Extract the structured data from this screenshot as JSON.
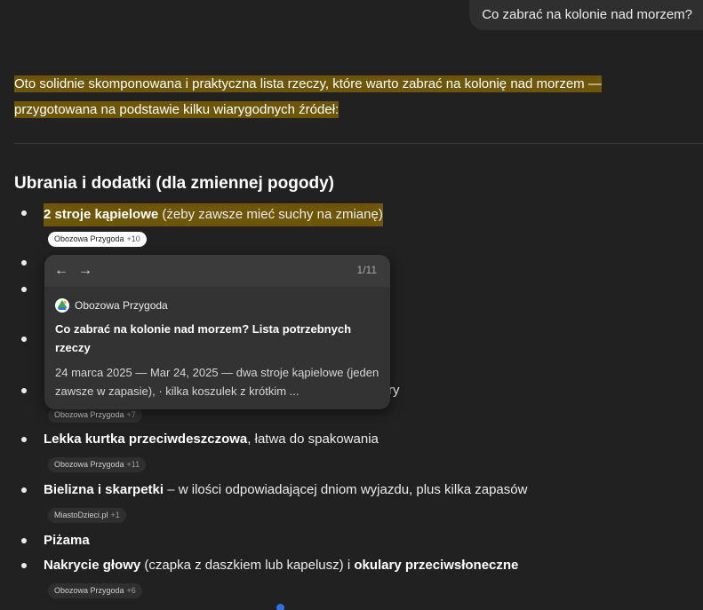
{
  "user_message": "Co zabrać na kolonie nad morzem?",
  "intro": "Oto solidnie skomponowana i praktyczna lista rzeczy, które warto zabrać na kolonię nad morzem — przygotowana na podstawie kilku wiarygodnych źródeł:",
  "section_heading": "Ubrania i dodatki (dla zmiennej pogody)",
  "items": [
    {
      "bold": "2 stroje kąpielowe",
      "rest": " (żeby zawsze mieć suchy na zmianę)"
    },
    {
      "bold": "Lekka kurtka przeciwdeszczowa",
      "rest": ", łatwa do spakowania"
    },
    {
      "bold": "Bielizna i skarpetki",
      "rest": " – w ilości odpowiadającej dniom wyjazdu, plus kilka zapasów"
    },
    {
      "bold": "Piżama",
      "rest": ""
    },
    {
      "bold": "Nakrycie głowy",
      "rest": " (czapka z daszkiem lub kapelusz) i ",
      "bold2": "okulary przeciwsłoneczne"
    }
  ],
  "hidden_item_tail": "ry",
  "chips": [
    {
      "source": "Obozowa Przygoda",
      "count": "+10"
    },
    {
      "source": "Obozowa Przygoda",
      "count": "+7"
    },
    {
      "source": "Obozowa Przygoda",
      "count": "+11"
    },
    {
      "source": "MiastoDzieci.pl",
      "count": "+1"
    },
    {
      "source": "Obozowa Przygoda",
      "count": "+6"
    }
  ],
  "popover": {
    "back_glyph": "←",
    "forward_glyph": "→",
    "counter": "1/11",
    "source_name": "Obozowa Przygoda",
    "title": "Co zabrać na kolonie nad morzem? Lista potrzebnych rzeczy",
    "snippet": "24 marca 2025 — Mar 24, 2025 — dwa stroje kąpielowe (jeden zawsze w zapasie), · kilka koszulek z krótkim ..."
  },
  "colors": {
    "background": "#212121",
    "highlight": "#6e5608",
    "popover": "#333333",
    "scroll_indicator": "#2f6fe8"
  }
}
